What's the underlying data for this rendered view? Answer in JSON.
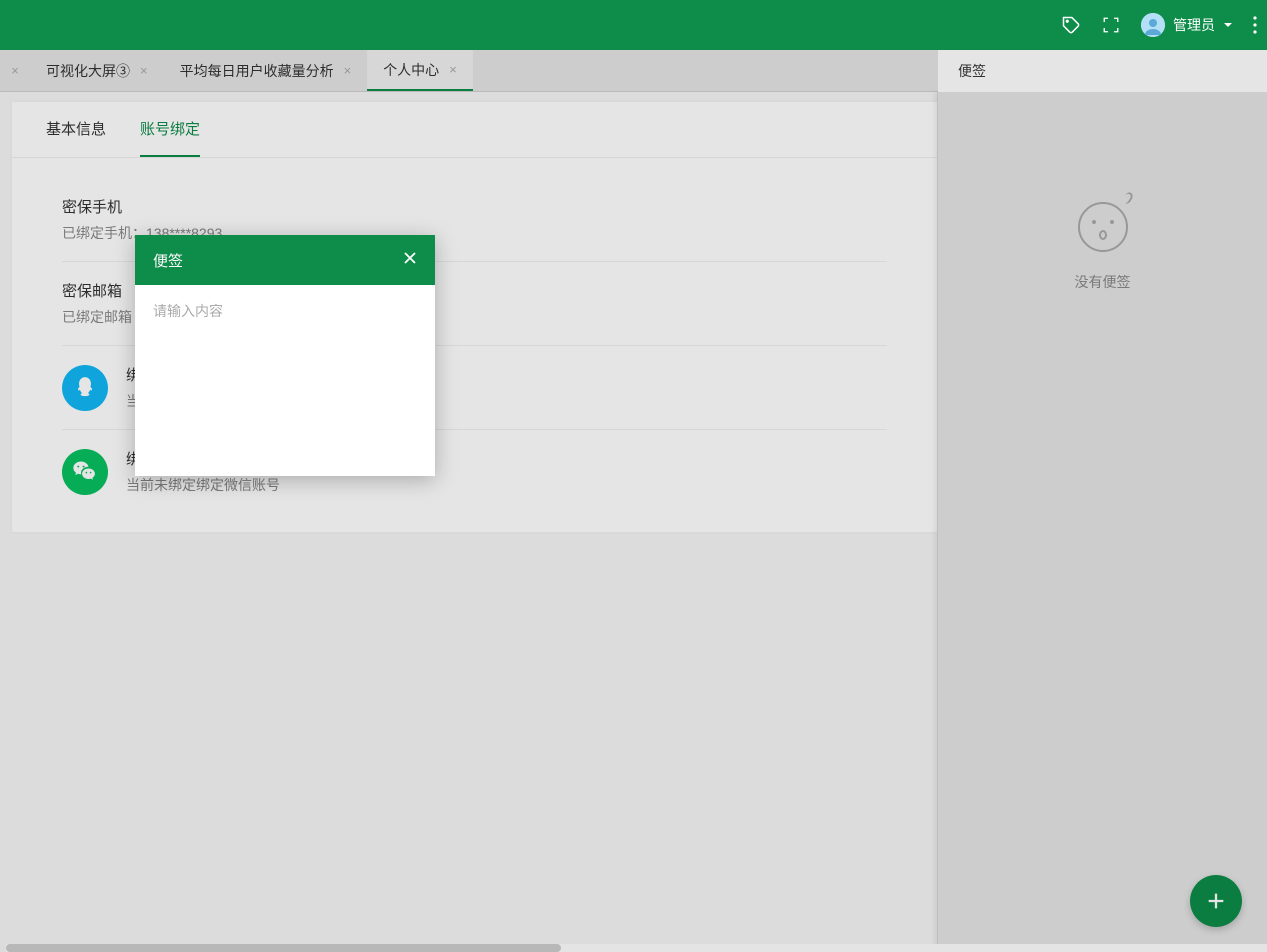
{
  "header": {
    "user_label": "管理员"
  },
  "tabs": [
    {
      "label": "可视化大屏③"
    },
    {
      "label": "平均每日用户收藏量分析"
    },
    {
      "label": "个人中心"
    }
  ],
  "card": {
    "tabs": [
      {
        "label": "基本信息"
      },
      {
        "label": "账号绑定"
      }
    ],
    "phone": {
      "title": "密保手机",
      "sub": "已绑定手机：138****8293"
    },
    "email": {
      "title": "密保邮箱",
      "sub": "已绑定邮箱"
    },
    "qq": {
      "title": "绑",
      "sub": "当"
    },
    "wechat": {
      "title": "绑定微信",
      "sub": "当前未绑定绑定微信账号"
    }
  },
  "sidepanel": {
    "title": "便签",
    "empty": "没有便签"
  },
  "note_dialog": {
    "title": "便签",
    "placeholder": "请输入内容"
  }
}
